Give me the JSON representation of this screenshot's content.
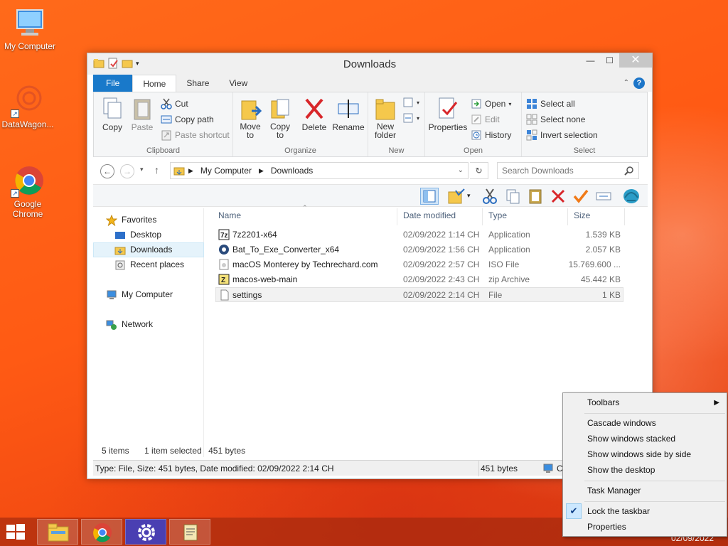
{
  "desktop": {
    "icons": [
      {
        "label": "My Computer",
        "icon": "computer-icon"
      },
      {
        "label": "DataWagon...",
        "icon": "datawagon-icon"
      },
      {
        "label": "Google Chrome",
        "icon": "chrome-icon"
      }
    ]
  },
  "window": {
    "title": "Downloads",
    "controls": {
      "minimize": "—",
      "maximize": "☐",
      "close": "✕"
    },
    "tabs": [
      "File",
      "Home",
      "Share",
      "View"
    ],
    "help": "?"
  },
  "ribbon": {
    "clipboard": {
      "label": "Clipboard",
      "copy": "Copy",
      "paste": "Paste",
      "cut": "Cut",
      "copy_path": "Copy path",
      "paste_shortcut": "Paste shortcut"
    },
    "organize": {
      "label": "Organize",
      "move_to": "Move to",
      "copy_to": "Copy to",
      "delete": "Delete",
      "rename": "Rename"
    },
    "new": {
      "label": "New",
      "new_folder": "New folder"
    },
    "open": {
      "label": "Open",
      "properties": "Properties",
      "open": "Open",
      "edit": "Edit",
      "history": "History"
    },
    "select": {
      "label": "Select",
      "select_all": "Select all",
      "select_none": "Select none",
      "invert": "Invert selection"
    }
  },
  "address": {
    "crumbs": [
      "My Computer",
      "Downloads"
    ],
    "search_placeholder": "Search Downloads"
  },
  "navpane": {
    "favorites": "Favorites",
    "desktop": "Desktop",
    "downloads": "Downloads",
    "recent": "Recent places",
    "my_computer": "My Computer",
    "network": "Network"
  },
  "columns": {
    "name": "Name",
    "date": "Date modified",
    "type": "Type",
    "size": "Size"
  },
  "files": [
    {
      "name": "7z2201-x64",
      "date": "02/09/2022 1:14 CH",
      "type": "Application",
      "size": "1.539 KB",
      "icon": "7zip-icon"
    },
    {
      "name": "Bat_To_Exe_Converter_x64",
      "date": "02/09/2022 1:56 CH",
      "type": "Application",
      "size": "2.057 KB",
      "icon": "gear-app-icon"
    },
    {
      "name": "macOS Monterey by Techrechard.com",
      "date": "02/09/2022 2:57 CH",
      "type": "ISO File",
      "size": "15.769.600 ...",
      "icon": "iso-file-icon"
    },
    {
      "name": "macos-web-main",
      "date": "02/09/2022 2:43 CH",
      "type": "zip Archive",
      "size": "45.442 KB",
      "icon": "zip-archive-icon"
    },
    {
      "name": "settings",
      "date": "02/09/2022 2:14 CH",
      "type": "File",
      "size": "1 KB",
      "icon": "blank-file-icon"
    }
  ],
  "status": {
    "items": "5 items",
    "selected": "1 item selected",
    "bytes": "451 bytes",
    "details": "Type: File, Size: 451 bytes, Date modified: 02/09/2022 2:14 CH",
    "details_bytes": "451 bytes",
    "details_tail": "C"
  },
  "taskbar": {
    "apps": [
      "file-explorer-icon",
      "chrome-icon",
      "settings-gear-icon",
      "script-scroll-icon"
    ],
    "clock_date": "02/09/2022"
  },
  "context_menu": {
    "toolbars": "Toolbars",
    "cascade": "Cascade windows",
    "stacked": "Show windows stacked",
    "side_by_side": "Show windows side by side",
    "show_desktop": "Show the desktop",
    "task_manager": "Task Manager",
    "lock_taskbar": "Lock the taskbar",
    "properties": "Properties",
    "lock_checked": true
  }
}
